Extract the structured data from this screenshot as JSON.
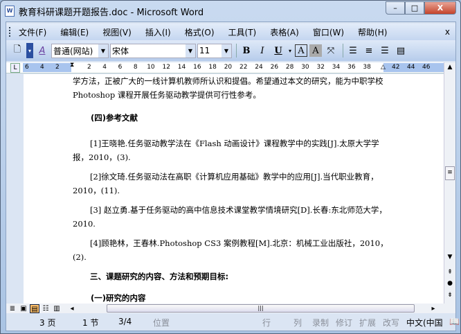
{
  "window": {
    "title": "教育科研课题开题报告.doc - Microsoft Word",
    "min": "–",
    "max": "□",
    "close": "X"
  },
  "menu": [
    "文件(F)",
    "编辑(E)",
    "视图(V)",
    "插入(I)",
    "格式(O)",
    "工具(T)",
    "表格(A)",
    "窗口(W)",
    "帮助(H)"
  ],
  "menu_close": "x",
  "toolbar": {
    "style": "普通(网站)",
    "font": "宋体",
    "size": "11",
    "bold": "B",
    "italic": "I",
    "underline": "U",
    "border_a": "A",
    "shade_a": "A",
    "style_icon": "A"
  },
  "ruler": {
    "left": [
      "6",
      "4",
      "2"
    ],
    "main": [
      "2",
      "4",
      "6",
      "8",
      "10",
      "12",
      "14",
      "16",
      "18",
      "20",
      "22",
      "24",
      "26",
      "28",
      "30",
      "32",
      "34",
      "36",
      "38"
    ],
    "right": [
      "42",
      "44",
      "46"
    ]
  },
  "document": {
    "p0": "学方法，正被广大的一线计算机教师所认识和提倡。希望通过本文的研究，能为中职学校 Photoshop 课程开展任务驱动教学提供可行性参考。",
    "h1": "(四)参考文献",
    "r1": "[1]王晓艳.任务驱动教学法在《Flash 动画设计》课程教学中的实践[J].太原大学学报，2010，(3).",
    "r2": "[2]徐文琦.任务驱动法在高职《计算机应用基础》教学中的应用[J].当代职业教育，2010，(11).",
    "r3": "[3] 赵立勇.基于任务驱动的高中信息技术课堂教学情境研究[D].长春:东北师范大学，2010.",
    "r4": "[4]顾艳林，王春林.Photoshop CS3 案例教程[M].北京：机械工业出版社，2010，(2).",
    "h2": "三、课题研究的内容、方法和预期目标:",
    "h3": "(一)研究的内容"
  },
  "status": {
    "page": "3 页",
    "section": "1 节",
    "pages": "3/4",
    "position": "位置",
    "line": "行",
    "col": "列",
    "rec": "录制",
    "trk": "修订",
    "ext": "扩展",
    "ovr": "改写",
    "lang": "中文(中国"
  }
}
